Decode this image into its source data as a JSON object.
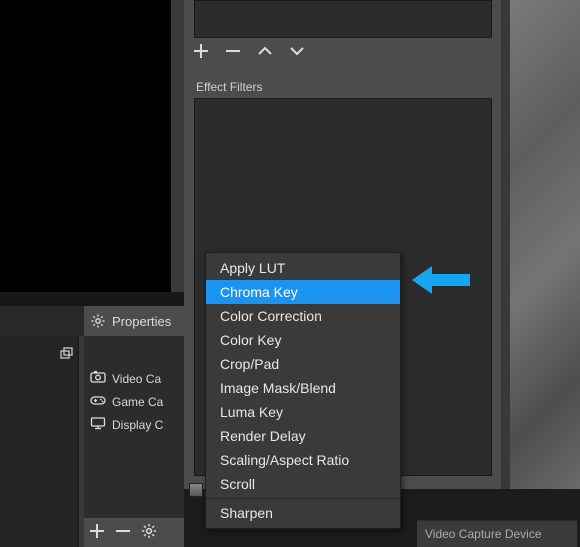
{
  "filter_panel": {
    "effect_filters_label": "Effect Filters"
  },
  "properties": {
    "label": "Properties"
  },
  "sources": {
    "items": [
      {
        "label": "Video Ca"
      },
      {
        "label": "Game Ca"
      },
      {
        "label": "Display C"
      }
    ]
  },
  "context_menu": {
    "items": [
      {
        "label": "Apply LUT",
        "highlight": false
      },
      {
        "label": "Chroma Key",
        "highlight": true
      },
      {
        "label": "Color Correction",
        "highlight": false
      },
      {
        "label": "Color Key",
        "highlight": false
      },
      {
        "label": "Crop/Pad",
        "highlight": false
      },
      {
        "label": "Image Mask/Blend",
        "highlight": false
      },
      {
        "label": "Luma Key",
        "highlight": false
      },
      {
        "label": "Render Delay",
        "highlight": false
      },
      {
        "label": "Scaling/Aspect Ratio",
        "highlight": false
      },
      {
        "label": "Scroll",
        "highlight": false
      },
      {
        "label": "Sharpen",
        "highlight": false
      }
    ]
  },
  "bottom_right": {
    "label": "Video Capture Device"
  }
}
